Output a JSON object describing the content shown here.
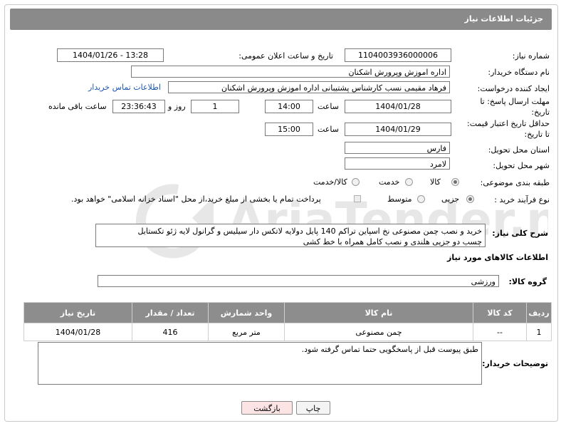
{
  "header": {
    "title": "جزئیات اطلاعات نیاز"
  },
  "need_number": {
    "label": "شماره نیاز:",
    "value": "1104003936000006"
  },
  "announce": {
    "label": "تاریخ و ساعت اعلان عمومی:",
    "value": "1404/01/26 - 13:28"
  },
  "buyer_org": {
    "label": "نام دستگاه خریدار:",
    "value": "اداره اموزش وپرورش اشکنان"
  },
  "creator": {
    "label": "ایجاد کننده درخواست:",
    "value": "فرهاد مقیمی نسب کارشناس پشتیبانی اداره اموزش وپرورش اشکنان",
    "contact_link": "اطلاعات تماس خریدار"
  },
  "reply_deadline": {
    "label_line1": "مهلت ارسال پاسخ: تا",
    "label_line2": "تاریخ:",
    "date": "1404/01/28",
    "time_label": "ساعت",
    "time": "14:00",
    "days": "1",
    "days_label": "روز و",
    "remaining": "23:36:43",
    "remaining_label": "ساعت باقی مانده"
  },
  "price_validity": {
    "label_line1": "حداقل تاریخ اعتبار قیمت:",
    "label_line2": "تا تاریخ:",
    "date": "1404/01/29",
    "time_label": "ساعت",
    "time": "15:00"
  },
  "province": {
    "label": "استان محل تحویل:",
    "value": "فارس"
  },
  "city": {
    "label": "شهر محل تحویل:",
    "value": "لامرد"
  },
  "category": {
    "label": "طبقه بندی موضوعی:",
    "options": [
      "کالا",
      "خدمت",
      "کالا/خدمت"
    ],
    "selected": "کالا"
  },
  "purchase_process": {
    "label": "نوع فرآیند خرید :",
    "options": [
      "جزیی",
      "متوسط"
    ],
    "selected": "جزیی",
    "note": "پرداخت تمام یا بخشی از مبلغ خرید،از محل \"اسناد خزانه اسلامی\" خواهد بود."
  },
  "description": {
    "label": "شرح کلی نیاز:",
    "line1": "خرید و نصب چمن مصنوعی نخ اسپاین تراکم 140 پایل دولایه لاتکس دار سیلیس و گرانول  لایه ژئو تکستایل",
    "line2": "چسب دو جزیی هلندی  و نصب کامل همراه با خط کشی"
  },
  "goods_section": {
    "title": "اطلاعات کالاهای مورد نیاز"
  },
  "goods_group": {
    "label": "گروه کالا:",
    "value": "ورزشی"
  },
  "table": {
    "headers": [
      "ردیف",
      "کد کالا",
      "نام کالا",
      "واحد شمارش",
      "تعداد / مقدار",
      "تاریخ نیاز"
    ],
    "rows": [
      [
        "1",
        "--",
        "چمن مصنوعی",
        "متر مربع",
        "416",
        "1404/01/28"
      ]
    ]
  },
  "buyer_notes": {
    "label": "توضیحات خریدار:",
    "value": "طبق پیوست قبل از پاسخگویی حتما تماس گرفته شود."
  },
  "buttons": {
    "print": "چاپ",
    "back": "بازگشت"
  },
  "watermark": {
    "text": "AriaTender.neT"
  },
  "colors": {
    "header_bg": "#8a8a8a",
    "link": "#1a56b0",
    "back_button_bg": "#fde4e4"
  }
}
